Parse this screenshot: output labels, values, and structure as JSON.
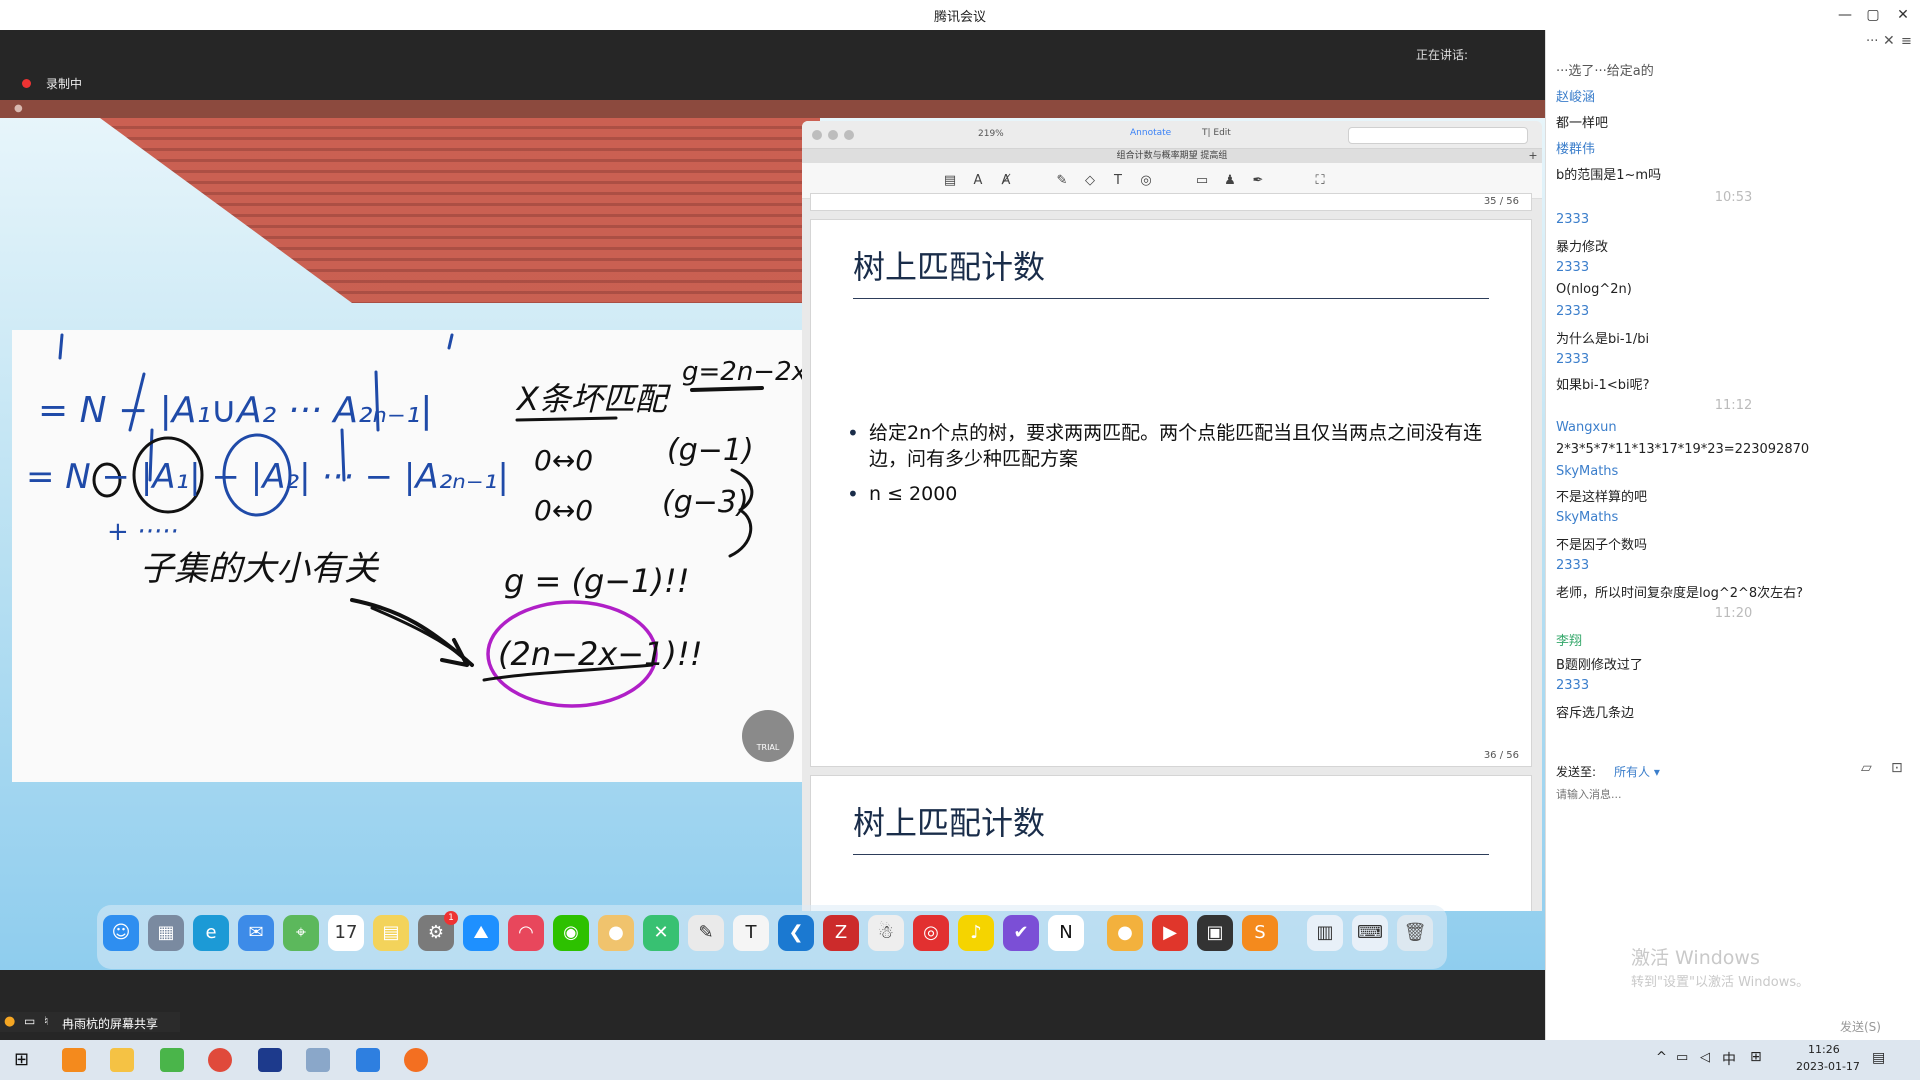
{
  "window": {
    "title": "腾讯会议",
    "controls": [
      "—",
      "▢",
      "✕"
    ]
  },
  "meeting": {
    "speaking_label": "正在讲话:",
    "recording_label": "录制中",
    "share_label": "冉雨杭的屏幕共享"
  },
  "pdf": {
    "zoom": "219%",
    "annotate_label": "Annotate",
    "edit_label": "T| Edit",
    "doc_title": "组合计数与概率期望 提高组",
    "pages": [
      {
        "num": "35 / 56"
      },
      {
        "title": "树上匹配计数",
        "bullets": [
          "给定2n个点的树，要求两两匹配。两个点能匹配当且仅当两点之间没有连边，问有多少种匹配方案",
          "n ≤ 2000"
        ],
        "num": "36 / 56"
      },
      {
        "title": "树上匹配计数"
      }
    ]
  },
  "whiteboard": {
    "trial_label": "TRIAL",
    "handwriting": [
      "= N − |A₁∪A₂ ··· A₂ₙ₋₁|",
      "= N − |A₁| − |A₂| ··· − |A₂ₙ₋₁|",
      "+ ·····",
      "子集的大小有关",
      "X条坏匹配",
      "g=2n−2x",
      "0↔0",
      "0↔0",
      "(g−1)",
      "(g−3)",
      "g = (g−1)!!",
      "(2n−2x−1)!!"
    ]
  },
  "dock": {
    "calendar_day": "17",
    "badge_count": "1",
    "apps": [
      "finder-icon",
      "launchpad-icon",
      "edge-icon",
      "mail-icon",
      "maps-icon",
      "calendar-icon",
      "notes-icon",
      "settings-icon",
      "pdf-icon",
      "app-icon",
      "wechat-icon",
      "app-icon",
      "app-icon",
      "app-icon",
      "typora-icon",
      "vscode-icon",
      "zotero-icon",
      "qq-icon",
      "music-icon",
      "app-icon",
      "todo-icon",
      "notion-icon",
      "app-icon",
      "app-icon",
      "app-icon",
      "app-icon",
      "folder-icon",
      "keyboard-icon",
      "trash-icon"
    ]
  },
  "chat": {
    "header_fragment": "···选了···给定a的",
    "messages": [
      {
        "sender": "赵峻涵",
        "text": "都一样吧"
      },
      {
        "sender": "楼群伟",
        "text": "b的范围是1~m吗"
      },
      {
        "time": "10:53"
      },
      {
        "sender": "2333",
        "text": "暴力修改"
      },
      {
        "sender": "2333",
        "text": "O(nlog^2n)"
      },
      {
        "sender": "2333",
        "text": "为什么是bi-1/bi"
      },
      {
        "sender": "2333",
        "text": "如果bi-1<bi呢?"
      },
      {
        "time": "11:12"
      },
      {
        "sender": "Wangxun",
        "text": "2*3*5*7*11*13*17*19*23=223092870"
      },
      {
        "sender": "SkyMaths",
        "text": "不是这样算的吧"
      },
      {
        "sender": "SkyMaths",
        "text": "不是因子个数吗"
      },
      {
        "sender": "2333",
        "text": "老师，所以时间复杂度是log^2^8次左右?"
      },
      {
        "time": "11:20"
      },
      {
        "sender": "李翔",
        "text": "B题刚修改过了",
        "green": true
      },
      {
        "sender": "2333",
        "text": "容斥选几条边"
      }
    ],
    "send_to_label": "发送至:",
    "send_target": "所有人 ▾",
    "input_placeholder": "请输入消息...",
    "send_button": "发送(S)",
    "activate_title": "激活 Windows",
    "activate_sub": "转到\"设置\"以激活 Windows。"
  },
  "taskbar": {
    "ime_label": "中",
    "time": "11:26",
    "date": "2023-01-17"
  }
}
